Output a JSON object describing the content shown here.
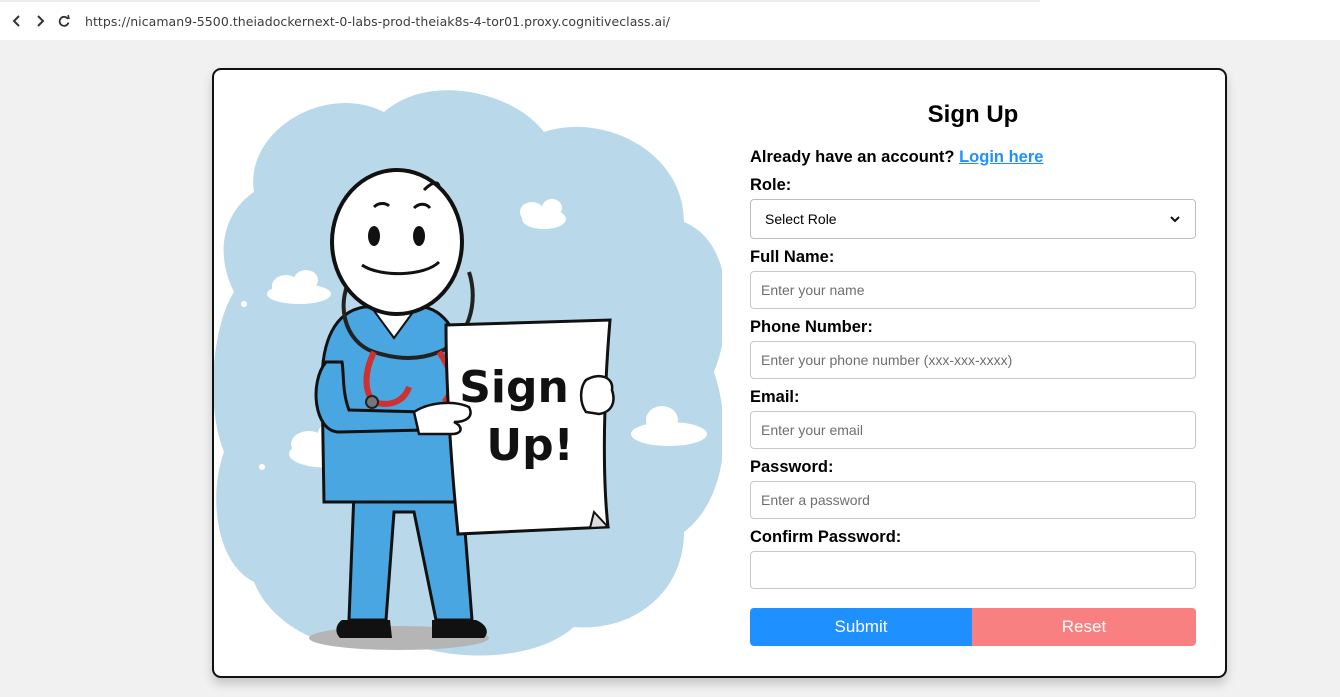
{
  "browser": {
    "url": "https://nicaman9-5500.theiadockernext-0-labs-prod-theiak8s-4-tor01.proxy.cognitiveclass.ai/"
  },
  "illustration": {
    "sign_text_line1": "Sign",
    "sign_text_line2": "Up!"
  },
  "form": {
    "title": "Sign Up",
    "already_text": "Already have an account?",
    "login_link": "Login here",
    "role_label": "Role:",
    "role_selected": "Select Role",
    "fullname_label": "Full Name:",
    "fullname_placeholder": "Enter your name",
    "phone_label": "Phone Number:",
    "phone_placeholder": "Enter your phone number (xxx-xxx-xxxx)",
    "email_label": "Email:",
    "email_placeholder": "Enter your email",
    "password_label": "Password:",
    "password_placeholder": "Enter a password",
    "confirm_label": "Confirm Password:",
    "confirm_placeholder": "",
    "submit_label": "Submit",
    "reset_label": "Reset"
  },
  "colors": {
    "submit_bg": "#1e90ff",
    "reset_bg": "#f88080",
    "link": "#1e90ff",
    "scrubs": "#4aa6e0",
    "cloud_bg": "#b9d9ea"
  }
}
